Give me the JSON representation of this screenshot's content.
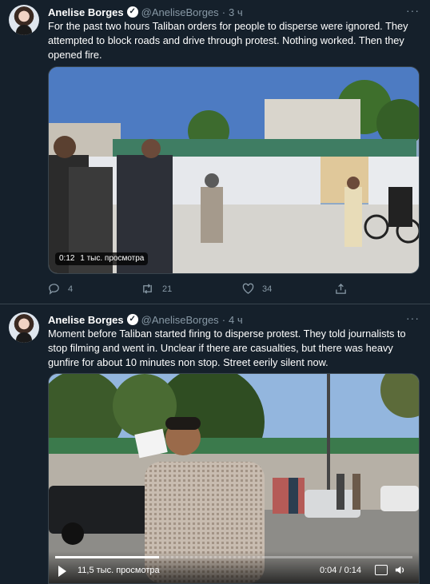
{
  "tweets": [
    {
      "author": "Anelise Borges",
      "handle": "@AneliseBorges",
      "time": "3 ч",
      "text": "For the past two hours Taliban orders for people to disperse were ignored. They attempted to block roads and drive through protest. Nothing worked. Then they opened fire.",
      "video_time": "0:12",
      "views": "1 тыс. просмотра",
      "replies": "4",
      "retweets": "21",
      "likes": "34"
    },
    {
      "author": "Anelise Borges",
      "handle": "@AneliseBorges",
      "time": "4 ч",
      "text": "Moment before Taliban started firing to disperse protest. They told journalists to stop filming and went in. Unclear if there are casualties, but there was heavy gunfire for about 10 minutes non stop. Street eerily silent now.",
      "views": "11,5 тыс. просмотра",
      "time_display": "0:04 / 0:14"
    }
  ],
  "separator": " · ",
  "colors": {
    "background": "#15202b",
    "muted": "#8899a6",
    "border": "#38444d"
  }
}
